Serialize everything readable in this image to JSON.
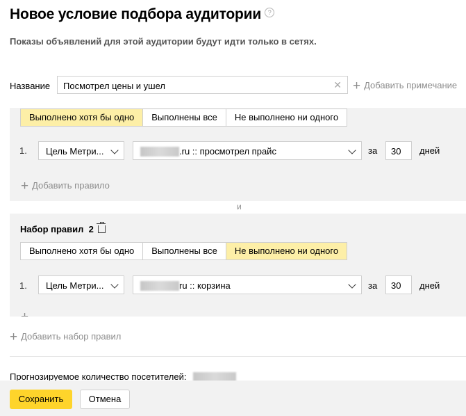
{
  "header": {
    "title": "Новое условие подбора аудитории",
    "help_icon": "?",
    "subtitle": "Показы объявлений для этой аудитории будут идти только в сетях."
  },
  "name_field": {
    "label": "Название",
    "value": "Посмотрел цены и ушел",
    "add_note": "Добавить примечание"
  },
  "conditions": {
    "options": [
      "Выполнено хотя бы одно",
      "Выполнены все",
      "Не выполнено ни одного"
    ]
  },
  "rule_set_1": {
    "active_option": "Выполнено хотя бы одно",
    "rule": {
      "index": "1.",
      "type": "Цель Метри...",
      "goal_suffix": ".ru :: просмотрел прайс",
      "for_label": "за",
      "days_value": "30",
      "days_label": "дней"
    },
    "add_rule": "Добавить правило"
  },
  "and_label": "и",
  "rule_set_2": {
    "title": "Набор правил  2",
    "active_option": "Не выполнено ни одного",
    "rule": {
      "index": "1.",
      "type": "Цель Метри...",
      "goal_suffix": "ru :: корзина",
      "for_label": "за",
      "days_value": "30",
      "days_label": "дней"
    }
  },
  "add_rule_set": "Добавить набор правил",
  "forecast_label": "Прогнозируемое количество посетителей:",
  "footer": {
    "save": "Сохранить",
    "cancel": "Отмена"
  },
  "colors": {
    "active_segment": "#fdefa7",
    "save_button": "#fed42b",
    "panel_bg": "#f2f2f2"
  }
}
